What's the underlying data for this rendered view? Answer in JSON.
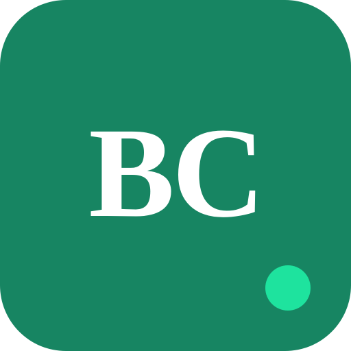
{
  "app_icon": {
    "monogram": "BC",
    "background_color": "#178562",
    "text_color": "#ffffff",
    "status_indicator": {
      "shape": "dot",
      "color": "#1ee39e"
    }
  }
}
